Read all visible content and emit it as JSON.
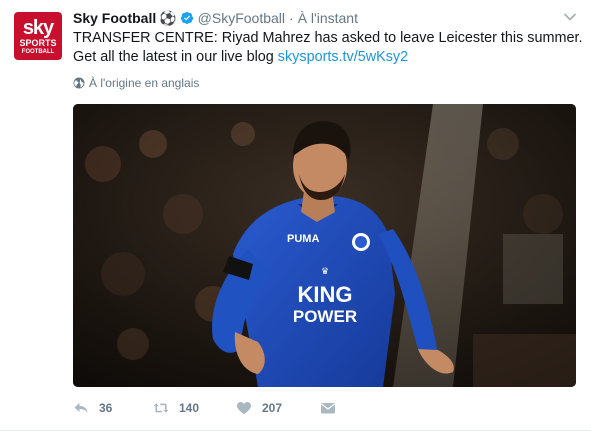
{
  "tweet": {
    "avatar": {
      "line1": "sky",
      "line2": "SPORTS",
      "line3": "FOOTBALL"
    },
    "fullname": "Sky Football",
    "name_emoji": "⚽",
    "handle": "@SkyFootball",
    "separator": "·",
    "time": "À l'instant",
    "text_plain": "TRANSFER CENTRE: Riyad Mahrez has asked to leave Leicester this summer. Get all the latest in our live blog ",
    "link": "skysports.tv/5wKsy2",
    "translate_label": "À l'origine en anglais",
    "media": {
      "shirt_line1": "KING",
      "shirt_line2": "POWER"
    },
    "actions": {
      "reply_count": "36",
      "retweet_count": "140",
      "like_count": "207"
    }
  },
  "colors": {
    "link": "#1b95e0",
    "muted": "#657786",
    "verified": "#1da1f2",
    "brand_red": "#c8102e",
    "kit_blue": "#1f49b8"
  }
}
